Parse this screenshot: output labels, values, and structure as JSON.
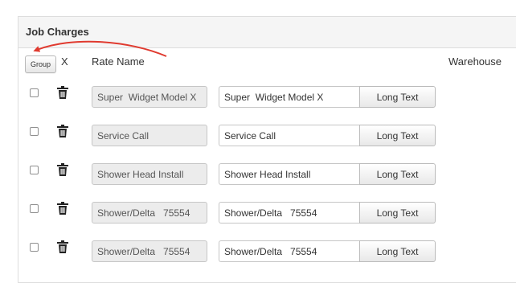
{
  "panel": {
    "title": "Job Charges"
  },
  "toolbar": {
    "group_label": "Group"
  },
  "columns": {
    "x": "X",
    "rate_name": "Rate Name",
    "warehouse": "Warehouse"
  },
  "annotation": {
    "arrow_color": "#e03a2f"
  },
  "rows": [
    {
      "rate_name": "Super  Widget Model X",
      "name_value": "Super  Widget Model X",
      "long_text_label": "Long Text"
    },
    {
      "rate_name": "Service Call",
      "name_value": "Service Call",
      "long_text_label": "Long Text"
    },
    {
      "rate_name": "Shower Head Install",
      "name_value": "Shower Head Install",
      "long_text_label": "Long Text"
    },
    {
      "rate_name": "Shower/Delta   75554",
      "name_value": "Shower/Delta   75554",
      "long_text_label": "Long Text"
    },
    {
      "rate_name": "Shower/Delta   75554",
      "name_value": "Shower/Delta   75554",
      "long_text_label": "Long Text"
    }
  ]
}
